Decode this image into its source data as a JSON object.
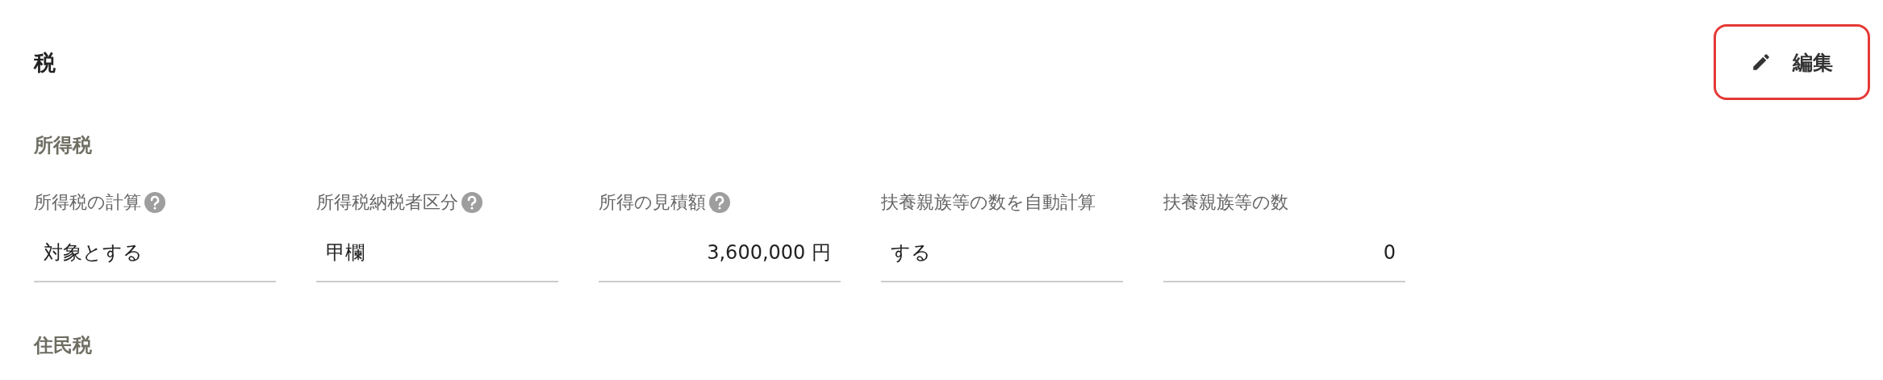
{
  "title": "税",
  "edit_button": {
    "label": "編集"
  },
  "sections": [
    {
      "heading": "所得税",
      "fields": [
        {
          "label": "所得税の計算",
          "help": true,
          "value": "対象とする",
          "kind": "text"
        },
        {
          "label": "所得税納税者区分",
          "help": true,
          "value": "甲欄",
          "kind": "text"
        },
        {
          "label": "所得の見積額",
          "help": true,
          "value": "3,600,000 円",
          "kind": "number"
        },
        {
          "label": "扶養親族等の数を自動計算",
          "help": false,
          "value": "する",
          "kind": "text"
        },
        {
          "label": "扶養親族等の数",
          "help": false,
          "value": "0",
          "kind": "number"
        }
      ]
    },
    {
      "heading": "住民税"
    }
  ]
}
